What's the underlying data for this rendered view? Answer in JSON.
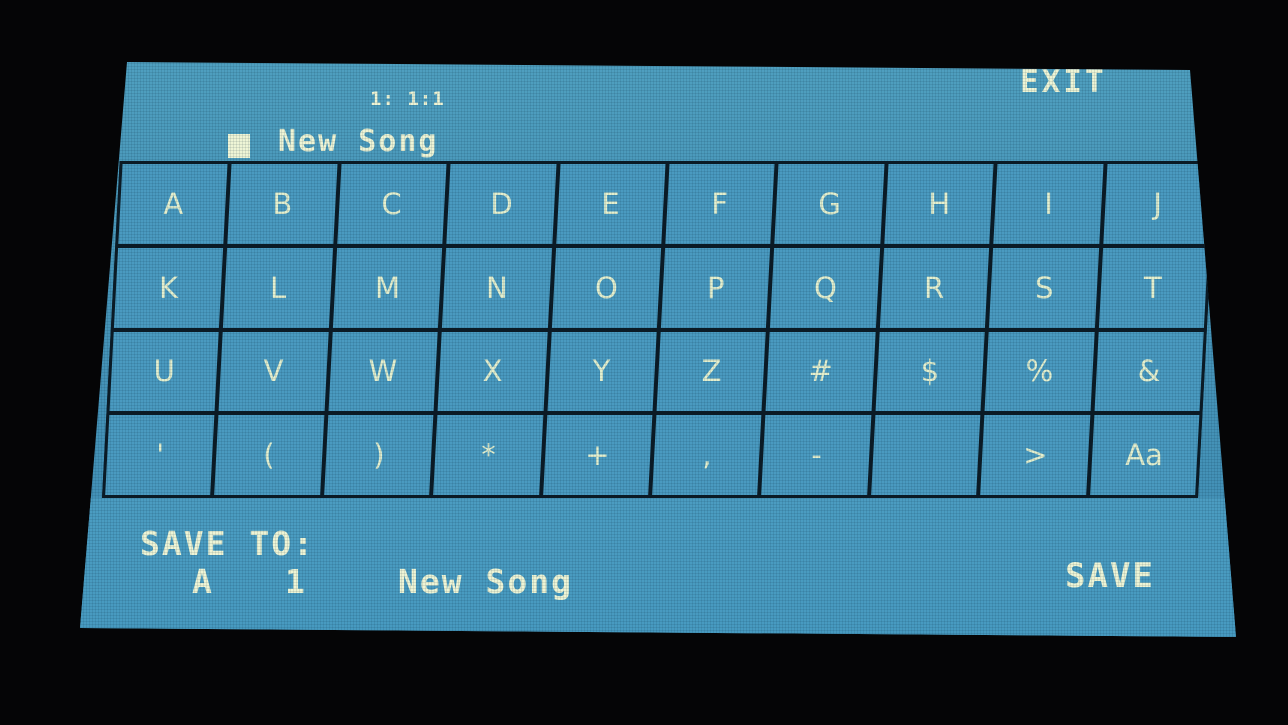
{
  "header": {
    "counter": "1: 1:1",
    "name_value": "New Song",
    "exit_label": "EXIT"
  },
  "keyboard": {
    "keys": [
      "A",
      "B",
      "C",
      "D",
      "E",
      "F",
      "G",
      "H",
      "I",
      "J",
      "K",
      "L",
      "M",
      "N",
      "O",
      "P",
      "Q",
      "R",
      "S",
      "T",
      "U",
      "V",
      "W",
      "X",
      "Y",
      "Z",
      "#",
      "$",
      "%",
      "&",
      "'",
      "(",
      ")",
      "*",
      "+",
      ",",
      "-",
      " ",
      ">",
      "Aa"
    ]
  },
  "footer": {
    "save_to_label": "SAVE TO:",
    "bank": "A",
    "slot": "1",
    "song_name": "New Song",
    "save_label": "SAVE"
  },
  "colors": {
    "screen": "#4694b8",
    "key": "#4a9ac0",
    "grid_lines": "#0b1a24",
    "text": "#eef5d6"
  }
}
